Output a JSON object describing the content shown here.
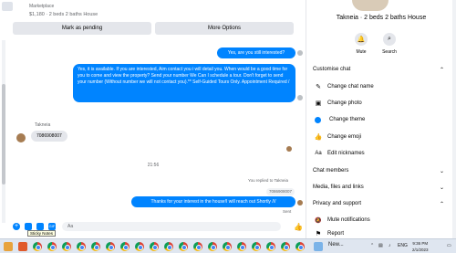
{
  "chat": {
    "marketplace_label": "Marketplace",
    "listing_title": "$1,180 · 2 beds 2 baths House",
    "mark_pending": "Mark as pending",
    "more_options": "More Options",
    "messages": [
      {
        "from": "me",
        "text": "Yes, are you still interested?"
      },
      {
        "from": "me",
        "text": "Yes, it is available. If you are interested,  Aim contact you i will detail you.  When would be a good time for you to come and view the property? Send your number We Can I schedule a tour.  Don't forget to send your number (Without number we will not contact you).** Self-Guided Tours Only. Appointment Required /"
      },
      {
        "from": "them",
        "sender": "Takneia",
        "text": "7086908007"
      },
      {
        "from": "me",
        "text": "Thanks for your interest in the house!I will reach out Shortly ///"
      }
    ],
    "timestamp": "21:56",
    "replied_to": "You replied to Takneia",
    "quoted_text": "7086908007",
    "sent_label": "Sent",
    "composer_placeholder": "Aa",
    "tooltip": "Sticky Notes"
  },
  "panel": {
    "title": "Takneia · 2 beds 2 baths House",
    "mute_label": "Mute",
    "search_label": "Search",
    "customise_chat": "Customise chat",
    "items": [
      {
        "icon": "pencil-icon",
        "glyph": "✎",
        "label": "Change chat name"
      },
      {
        "icon": "photo-icon",
        "glyph": "▣",
        "label": "Change photo"
      },
      {
        "icon": "theme-icon",
        "glyph": "●",
        "label": "Change theme"
      },
      {
        "icon": "thumbs-up-icon",
        "glyph": "👍",
        "label": "Change emoji"
      },
      {
        "icon": "aa-icon",
        "glyph": "Aa",
        "label": "Edit nicknames"
      }
    ],
    "chat_members": "Chat members",
    "media_files": "Media, files and links",
    "privacy": "Privacy and support",
    "privacy_items": [
      {
        "icon": "bell-mute-icon",
        "glyph": "🔕",
        "label": "Mute notifications"
      },
      {
        "icon": "report-icon",
        "glyph": "⚑",
        "label": "Report"
      }
    ]
  },
  "taskbar": {
    "news_label": "New...",
    "lang": "ENG",
    "time": "9:36 PM",
    "date": "2/1/2023"
  },
  "colors": {
    "accent": "#0084ff",
    "bubble_in": "#e4e6eb"
  }
}
